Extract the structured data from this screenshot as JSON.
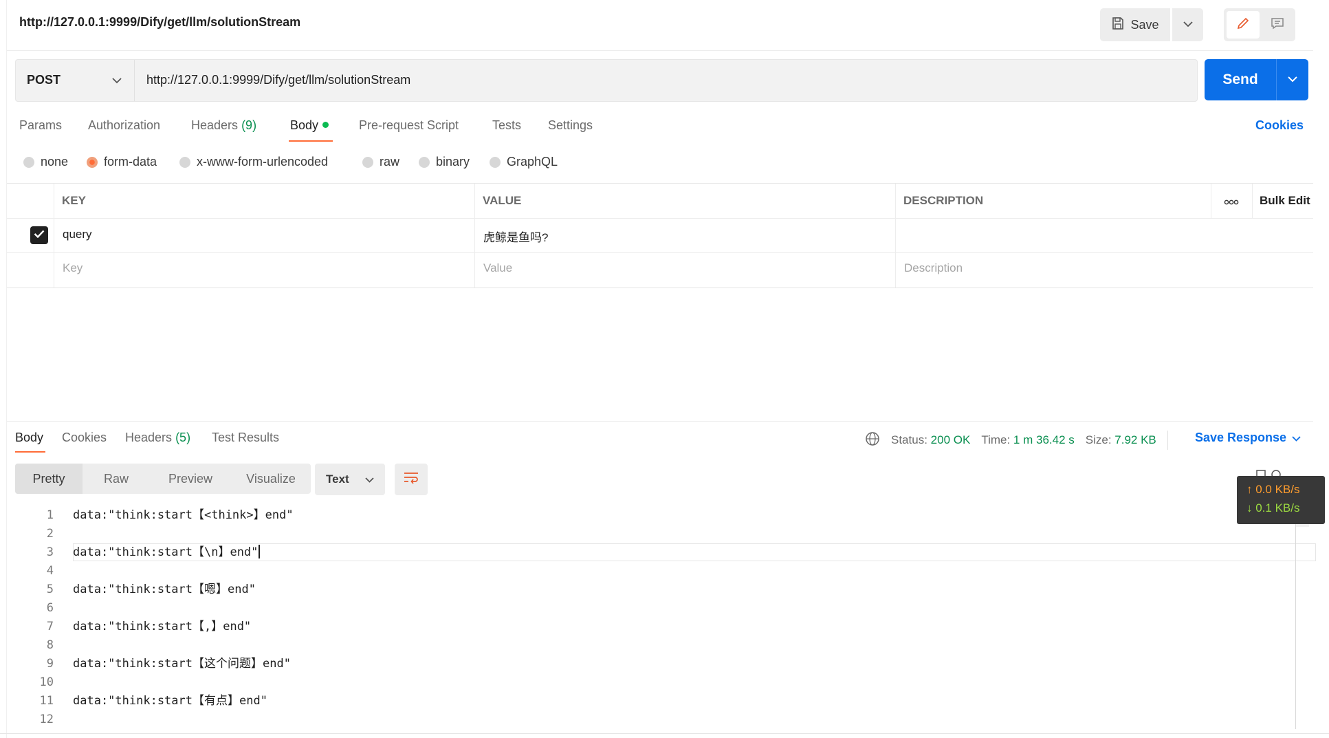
{
  "header": {
    "title": "http://127.0.0.1:9999/Dify/get/llm/solutionStream",
    "save_label": "Save"
  },
  "request": {
    "method": "POST",
    "url": "http://127.0.0.1:9999/Dify/get/llm/solutionStream",
    "send_label": "Send",
    "tabs": {
      "params": "Params",
      "authorization": "Authorization",
      "headers": "Headers",
      "headers_count": "(9)",
      "body": "Body",
      "prerequest": "Pre-request Script",
      "tests": "Tests",
      "settings": "Settings"
    },
    "cookies_label": "Cookies",
    "body_types": [
      "none",
      "form-data",
      "x-www-form-urlencoded",
      "raw",
      "binary",
      "GraphQL"
    ],
    "body_type_selected": "form-data",
    "table": {
      "headers": {
        "key": "KEY",
        "value": "VALUE",
        "description": "DESCRIPTION",
        "bulk_edit": "Bulk Edit"
      },
      "rows": [
        {
          "checked": true,
          "key": "query",
          "value": "虎鲸是鱼吗?",
          "description": ""
        }
      ],
      "placeholders": {
        "key": "Key",
        "value": "Value",
        "description": "Description"
      }
    }
  },
  "response": {
    "tabs": {
      "body": "Body",
      "cookies": "Cookies",
      "headers": "Headers",
      "headers_count": "(5)",
      "test_results": "Test Results"
    },
    "status_label": "Status:",
    "status_value": "200 OK",
    "time_label": "Time:",
    "time_value": "1 m 36.42 s",
    "size_label": "Size:",
    "size_value": "7.92 KB",
    "save_response": "Save Response",
    "views": [
      "Pretty",
      "Raw",
      "Preview",
      "Visualize"
    ],
    "format": "Text",
    "lines": [
      {
        "n": "1",
        "text": "data:\"think:start【<think>】end\""
      },
      {
        "n": "2",
        "text": ""
      },
      {
        "n": "3",
        "text": "data:\"think:start【\\n】end\""
      },
      {
        "n": "4",
        "text": ""
      },
      {
        "n": "5",
        "text": "data:\"think:start【嗯】end\""
      },
      {
        "n": "6",
        "text": ""
      },
      {
        "n": "7",
        "text": "data:\"think:start【,】end\""
      },
      {
        "n": "8",
        "text": ""
      },
      {
        "n": "9",
        "text": "data:\"think:start【这个问题】end\""
      },
      {
        "n": "10",
        "text": ""
      },
      {
        "n": "11",
        "text": "data:\"think:start【有点】end\""
      },
      {
        "n": "12",
        "text": ""
      }
    ]
  },
  "speed_widget": {
    "up": "↑ 0.0 KB/s",
    "down": "↓ 0.1 KB/s"
  },
  "colors": {
    "accent": "#0b6fe8",
    "brand_orange": "#ff6c37",
    "success": "#0a8f50"
  }
}
